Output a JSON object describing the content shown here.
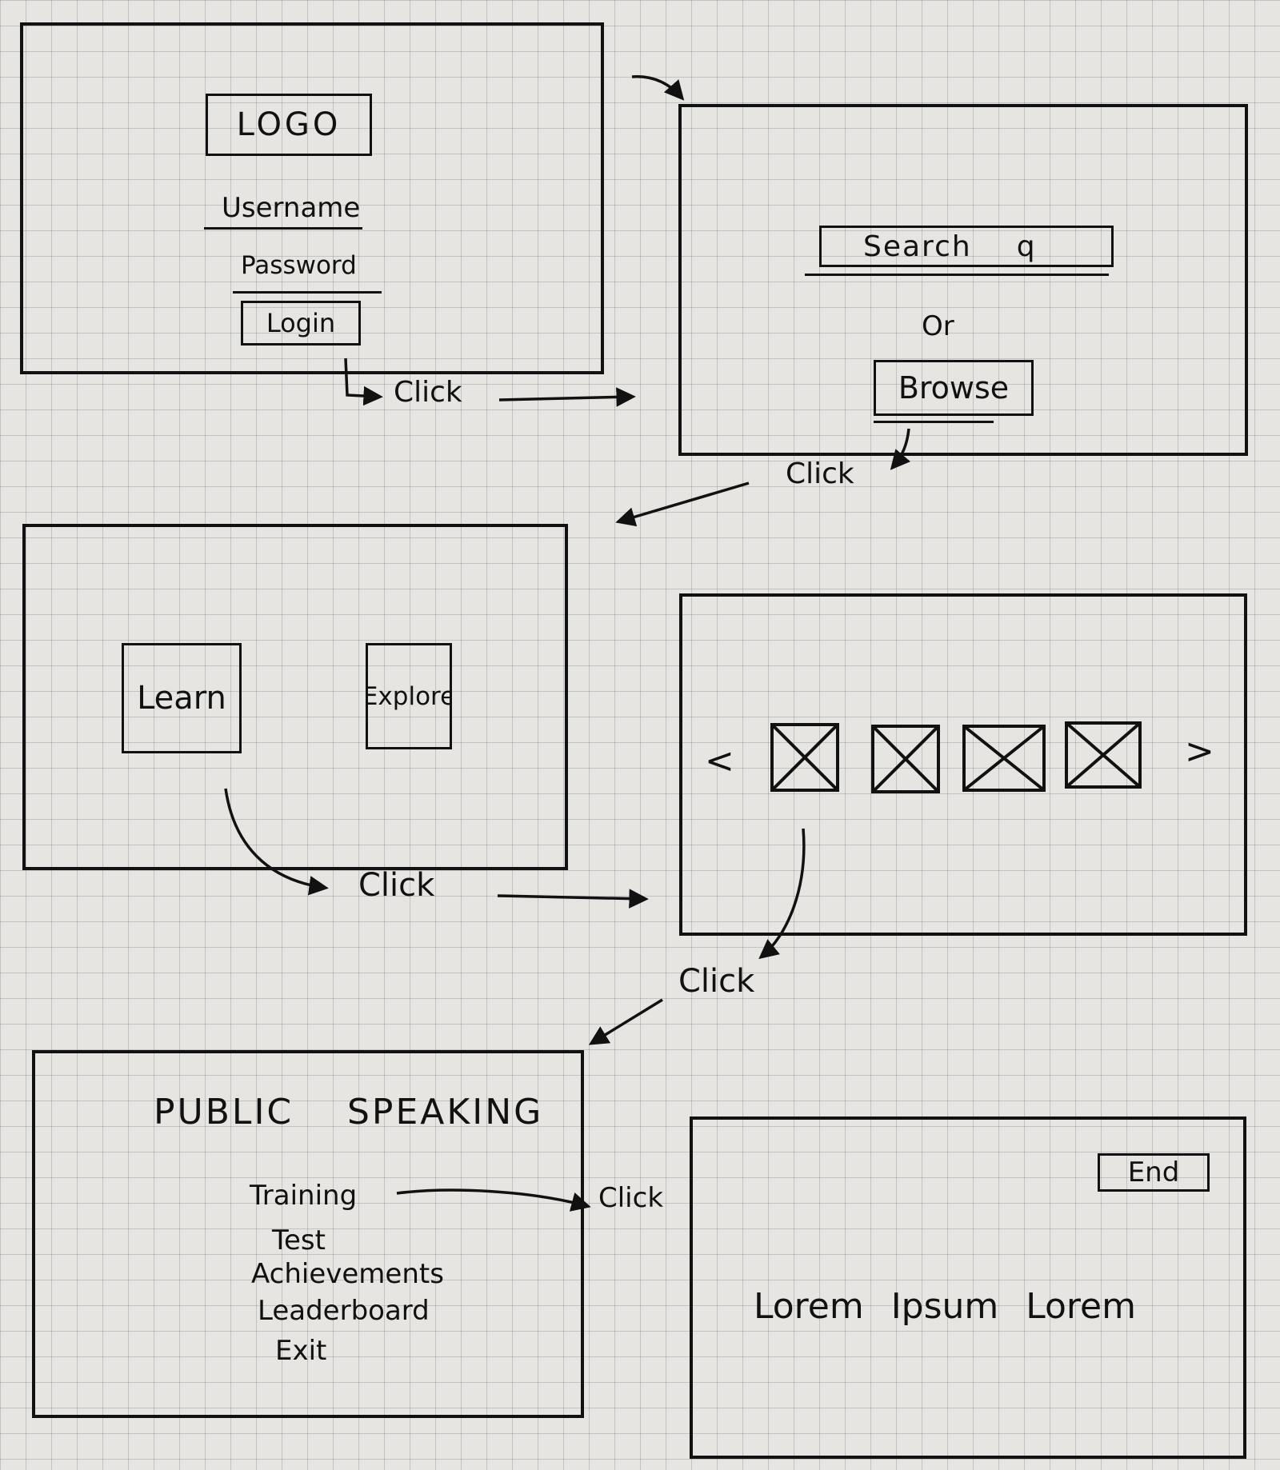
{
  "screens": {
    "login": {
      "logo": "LOGO",
      "username": "Username",
      "password": "Password",
      "login_button": "Login"
    },
    "search": {
      "search_placeholder": "Search",
      "search_icon": "magnifier-q",
      "or_text": "Or",
      "browse_button": "Browse"
    },
    "choice": {
      "learn_button": "Learn",
      "explore_button": "Explore"
    },
    "carousel": {
      "prev": "<",
      "next": ">",
      "thumbnail_count": 4
    },
    "menu": {
      "title_left": "PUBLIC",
      "title_right": "SPEAKING",
      "items": [
        "Training",
        "Test",
        "Achievements",
        "Leaderboard",
        "Exit"
      ]
    },
    "content": {
      "end_button": "End",
      "body_text": "Lorem Ipsum Lorem"
    }
  },
  "flow_labels": {
    "click_1": "Click",
    "click_2": "Click",
    "click_3": "Click",
    "click_4": "Click",
    "click_5": "Click"
  }
}
